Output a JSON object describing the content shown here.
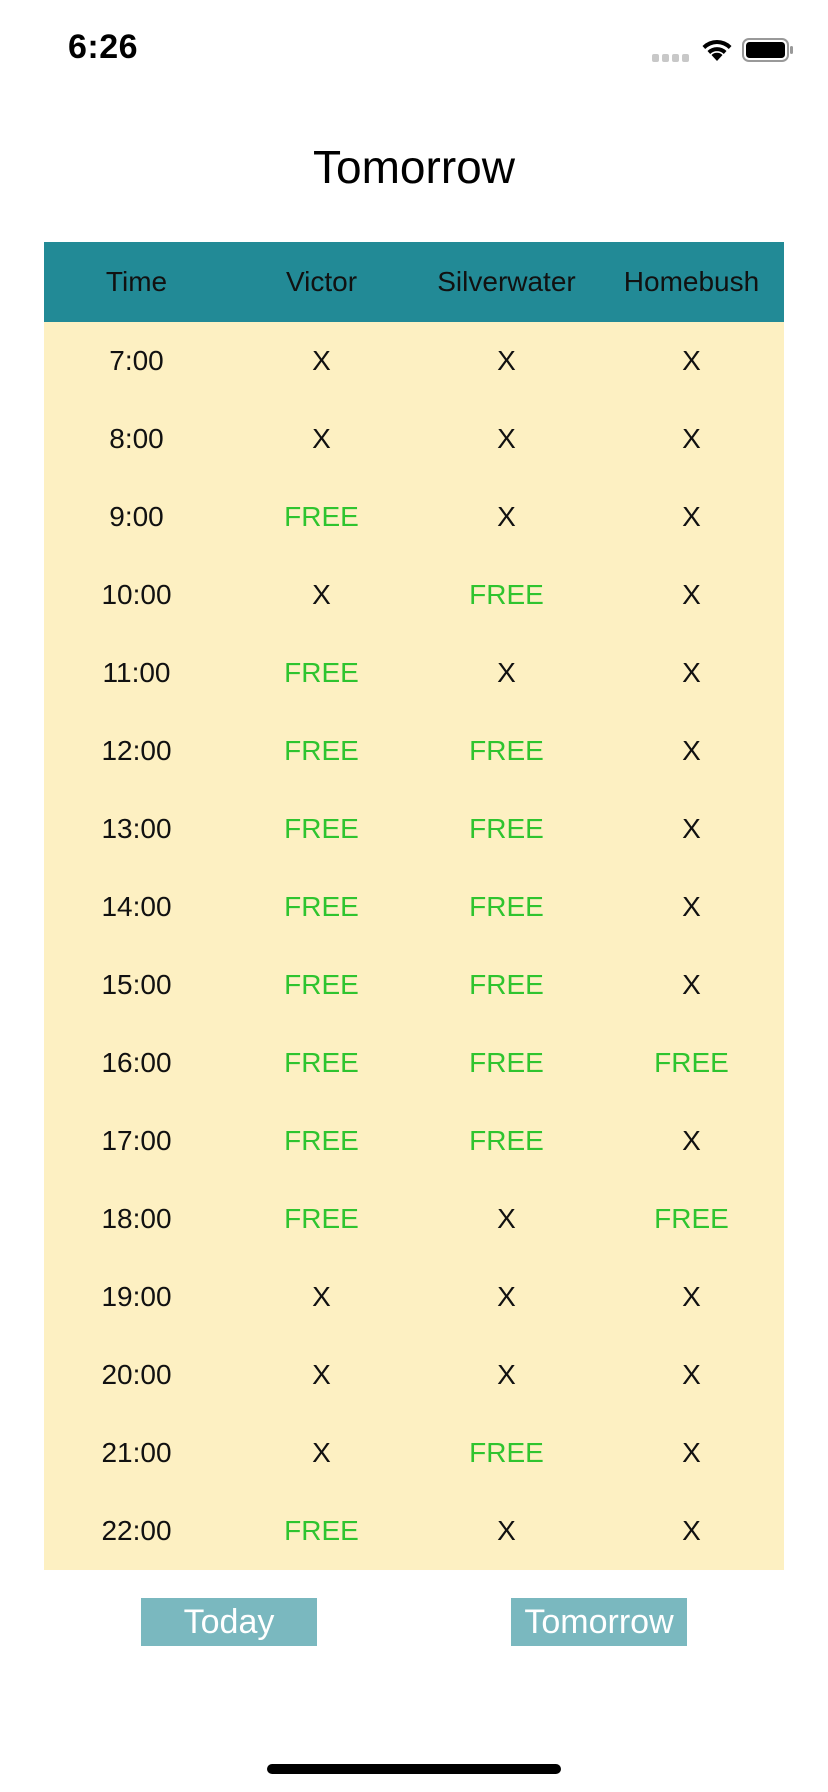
{
  "status_bar": {
    "time": "6:26",
    "icons": [
      "signal-icon",
      "wifi-icon",
      "battery-icon"
    ]
  },
  "page": {
    "title": "Tomorrow"
  },
  "table": {
    "columns": [
      "Time",
      "Victor",
      "Silverwater",
      "Homebush"
    ],
    "rows": [
      [
        "7:00",
        "X",
        "X",
        "X"
      ],
      [
        "8:00",
        "X",
        "X",
        "X"
      ],
      [
        "9:00",
        "FREE",
        "X",
        "X"
      ],
      [
        "10:00",
        "X",
        "FREE",
        "X"
      ],
      [
        "11:00",
        "FREE",
        "X",
        "X"
      ],
      [
        "12:00",
        "FREE",
        "FREE",
        "X"
      ],
      [
        "13:00",
        "FREE",
        "FREE",
        "X"
      ],
      [
        "14:00",
        "FREE",
        "FREE",
        "X"
      ],
      [
        "15:00",
        "FREE",
        "FREE",
        "X"
      ],
      [
        "16:00",
        "FREE",
        "FREE",
        "FREE"
      ],
      [
        "17:00",
        "FREE",
        "FREE",
        "X"
      ],
      [
        "18:00",
        "FREE",
        "X",
        "FREE"
      ],
      [
        "19:00",
        "X",
        "X",
        "X"
      ],
      [
        "20:00",
        "X",
        "X",
        "X"
      ],
      [
        "21:00",
        "X",
        "FREE",
        "X"
      ],
      [
        "22:00",
        "FREE",
        "X",
        "X"
      ]
    ]
  },
  "buttons": {
    "today_label": "Today",
    "tomorrow_label": "Tomorrow"
  },
  "colors": {
    "header_bg": "#228a96",
    "table_bg": "#fdf0c2",
    "free_text": "#2fc42f",
    "button_bg": "#7ab8bf"
  }
}
